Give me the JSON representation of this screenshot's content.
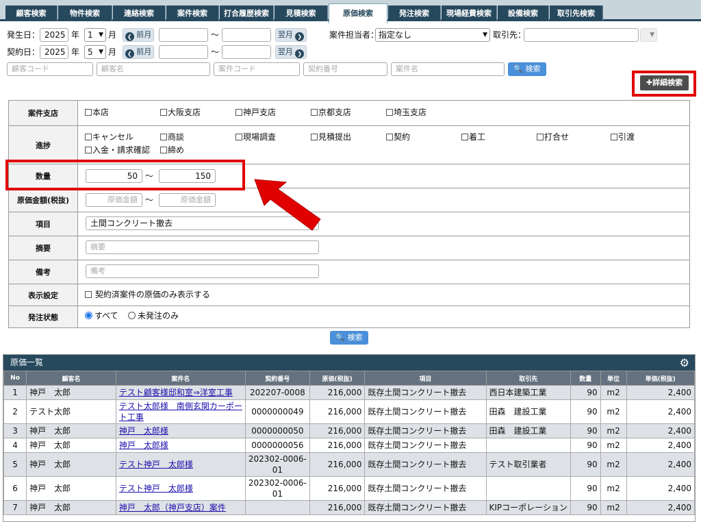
{
  "tabs": [
    "顧客検索",
    "物件検索",
    "連絡検索",
    "案件検索",
    "打合履歴検索",
    "見積検索",
    "原価検索",
    "発注検索",
    "現場経費検索",
    "設備検索",
    "取引先検索"
  ],
  "filters": {
    "occurrence_date_label": "発生日：",
    "contract_date_label": "契約日：",
    "year": "2025",
    "year_unit": "年",
    "occurrence_month": "1",
    "contract_month": "5",
    "month_unit": "月",
    "prev_month": "前月",
    "next_month": "翌月",
    "tilde": "～",
    "staff_label": "案件担当者：",
    "staff_value": "指定なし",
    "supplier_label": "取引先：",
    "placeholders": {
      "customer_code": "顧客コード",
      "customer_name": "顧客名",
      "case_code": "案件コード",
      "contract_no": "契約番号",
      "case_name": "案件名"
    },
    "search_button": "検索",
    "detail_search_button": "詳細検索"
  },
  "detail": {
    "branch_label": "案件支店",
    "branches": [
      "本店",
      "大阪支店",
      "神戸支店",
      "京都支店",
      "埼玉支店"
    ],
    "progress_label": "進捗",
    "progress_options": [
      "キャンセル",
      "商談",
      "現場調査",
      "見積提出",
      "契約",
      "着工",
      "打合せ",
      "引渡",
      "入金・請求確認",
      "締め"
    ],
    "quantity_label": "数量",
    "quantity_from": "50",
    "quantity_to": "150",
    "cost_label": "原価金額(税抜)",
    "cost_placeholder": "原価金額",
    "item_label": "項目",
    "item_value": "土間コンクリート撤去",
    "summary_label": "摘要",
    "summary_placeholder": "摘要",
    "remarks_label": "備考",
    "remarks_placeholder": "備考",
    "display_label": "表示設定",
    "display_option": "契約済案件の原価のみ表示する",
    "order_status_label": "発注状態",
    "order_all": "すべて",
    "order_unordered": "未発注のみ",
    "search_button": "検索"
  },
  "grid": {
    "title": "原価一覧",
    "columns": [
      "No",
      "顧客名",
      "案件名",
      "契約番号",
      "原価(税抜)",
      "項目",
      "取引先",
      "数量",
      "単位",
      "単価(税抜)"
    ],
    "rows": [
      {
        "no": "1",
        "customer": "神戸　太郎",
        "case": "テスト顧客様邸和室⇒洋室工事",
        "case2": "",
        "contract": "202207-0008",
        "contract2": "",
        "cost": "216,000",
        "item": "既存土間コンクリート撤去",
        "supplier": "西日本建築工業",
        "qty": "90",
        "unit": "m2",
        "price": "2,400"
      },
      {
        "no": "2",
        "customer": "テスト太郎",
        "case": "テスト太郎様　南側玄関カーポー",
        "case2": "ト工事",
        "contract": "0000000049",
        "contract2": "",
        "cost": "216,000",
        "item": "既存土間コンクリート撤去",
        "supplier": "田森　建設工業",
        "qty": "90",
        "unit": "m2",
        "price": "2,400"
      },
      {
        "no": "3",
        "customer": "神戸　太郎",
        "case": "神戸　太郎様",
        "case2": "",
        "contract": "0000000050",
        "contract2": "",
        "cost": "216,000",
        "item": "既存土間コンクリート撤去",
        "supplier": "田森　建設工業",
        "qty": "90",
        "unit": "m2",
        "price": "2,400"
      },
      {
        "no": "4",
        "customer": "神戸　太郎",
        "case": "神戸　太郎様",
        "case2": "",
        "contract": "0000000056",
        "contract2": "",
        "cost": "216,000",
        "item": "既存土間コンクリート撤去",
        "supplier": "",
        "qty": "90",
        "unit": "m2",
        "price": "2,400"
      },
      {
        "no": "5",
        "customer": "神戸　太郎",
        "case": "テスト神戸　太郎様",
        "case2": "",
        "contract": "202302-0006-",
        "contract2": "01",
        "cost": "216,000",
        "item": "既存土間コンクリート撤去",
        "supplier": "テスト取引業者",
        "qty": "90",
        "unit": "m2",
        "price": "2,400"
      },
      {
        "no": "6",
        "customer": "神戸　太郎",
        "case": "テスト神戸　太郎様",
        "case2": "",
        "contract": "202302-0006-",
        "contract2": "01",
        "cost": "216,000",
        "item": "既存土間コンクリート撤去",
        "supplier": "",
        "qty": "90",
        "unit": "m2",
        "price": "2,400"
      },
      {
        "no": "7",
        "customer": "神戸　太郎",
        "case": "神戸　太郎（神戸支店）案件",
        "case2": "",
        "contract": "",
        "contract2": "",
        "cost": "216,000",
        "item": "既存土間コンクリート撤去",
        "supplier": "KIPコーポレーション",
        "qty": "90",
        "unit": "m2",
        "price": "2,400"
      }
    ]
  },
  "colors": {
    "navy": "#27495e",
    "highlight_red": "#e00000",
    "link": "#1a0dab",
    "search_blue": "#4a8fd9"
  }
}
